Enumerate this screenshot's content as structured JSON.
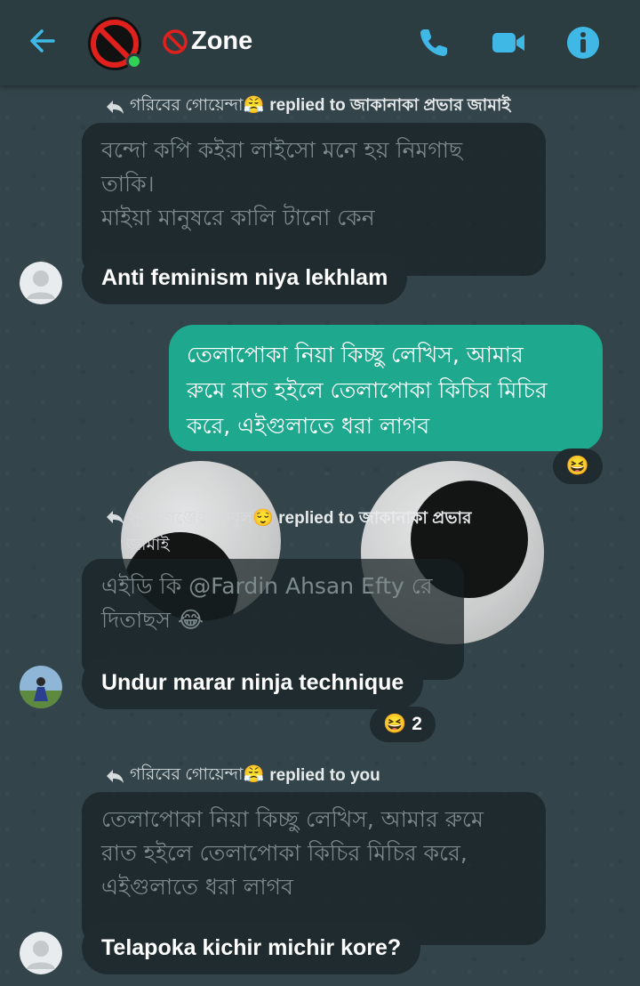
{
  "header": {
    "back_icon": "arrow-left-icon",
    "title": "Zone",
    "title_icon": "prohibited-icon",
    "call_icon": "phone-icon",
    "video_icon": "video-icon",
    "info_icon": "info-icon",
    "accent": "#3fb8e6",
    "online_color": "#31d158"
  },
  "messages": [
    {
      "reply_from": "গরিবের গোয়েন্দা😤",
      "reply_text": "replied to জাকানাকা প্রভার জামাই",
      "quoted": [
        "বন্দো কপি কইরা লাইসো মনে হয় নিমগাছ",
        "তাকি।",
        "মাইয়া মানুষরে কালি টানো কেন"
      ],
      "body": "Anti feminism niya lekhlam"
    },
    {
      "mine_lines": [
        "তেলাপোকা নিয়া কিচ্ছু লেখিস, আমার",
        "রুমে রাত হইলে তেলাপোকা কিচির মিচির",
        "করে, এইগুলাতে ধরা লাগব"
      ],
      "reaction": "😆"
    },
    {
      "reply_from": "সুনামগঞ্জের আবুল😌",
      "reply_text": "replied to জাকানাকা প্রভার",
      "reply_text2": "জামাই",
      "quoted": [
        "এইডি কি @Fardin Ahsan Efty রে",
        "দিতাছস 😂"
      ],
      "body": "Undur marar ninja technique",
      "reaction": "😆",
      "reaction_count": "2"
    },
    {
      "reply_from": "গরিবের গোয়েন্দা😤",
      "reply_text": "replied to you",
      "quoted": [
        "তেলাপোকা নিয়া কিচ্ছু লেখিস, আমার রুমে",
        "রাত হইলে তেলাপোকা কিচির মিচির করে,",
        "এইগুলাতে ধরা লাগব"
      ],
      "body": "Telapoka kichir michir kore?"
    }
  ]
}
